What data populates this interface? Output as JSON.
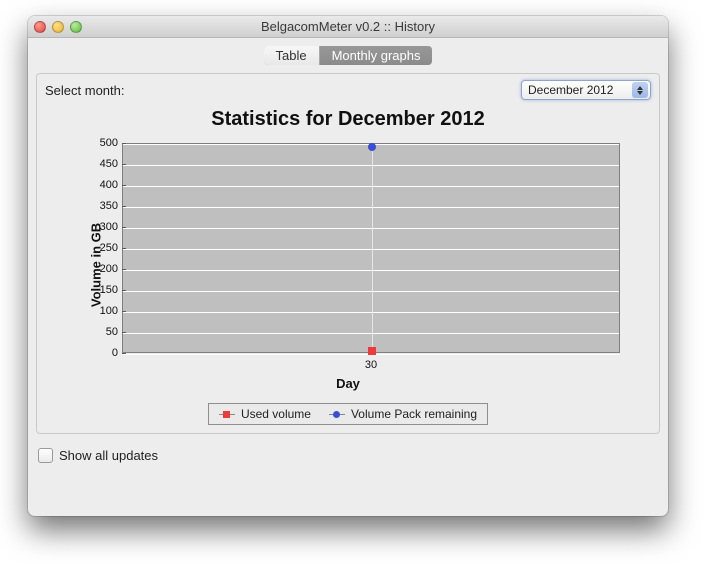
{
  "window": {
    "title": "BelgacomMeter v0.2 :: History"
  },
  "tabs": [
    {
      "label": "Table",
      "active": false
    },
    {
      "label": "Monthly graphs",
      "active": true
    }
  ],
  "controls": {
    "select_label": "Select month:",
    "month_selected": "December 2012"
  },
  "footer": {
    "show_all_updates_label": "Show all updates",
    "show_all_updates_checked": false
  },
  "chart_data": {
    "type": "scatter",
    "title": "Statistics for December 2012",
    "xlabel": "Day",
    "ylabel": "Volume in GB",
    "ylim": [
      0,
      500
    ],
    "yticks": [
      0,
      50,
      100,
      150,
      200,
      250,
      300,
      350,
      400,
      450,
      500
    ],
    "xticks": [
      30
    ],
    "series": [
      {
        "name": "Used volume",
        "color": "#ee3a3a",
        "marker": "square",
        "points": [
          {
            "x": 30,
            "y": 8
          }
        ]
      },
      {
        "name": "Volume Pack remaining",
        "color": "#3a4fd6",
        "marker": "circle",
        "points": [
          {
            "x": 30,
            "y": 492
          }
        ]
      }
    ]
  }
}
